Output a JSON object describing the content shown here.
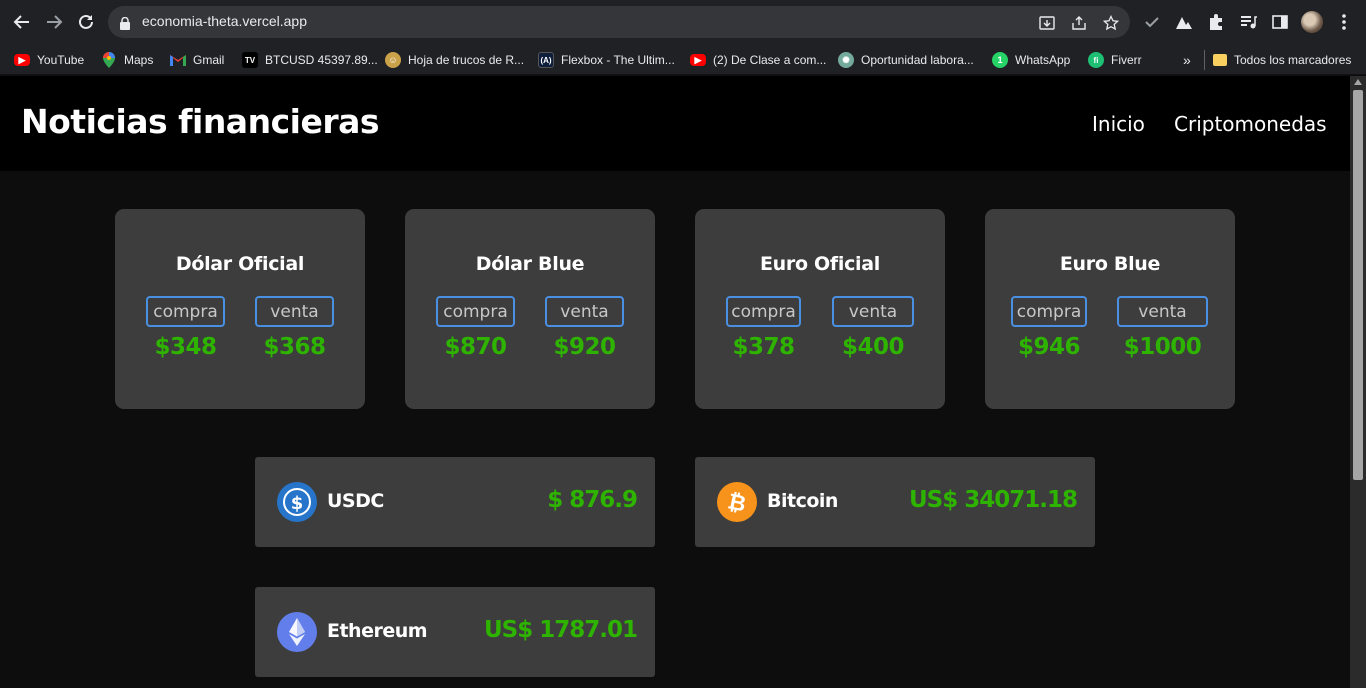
{
  "browser": {
    "url": "economia-theta.vercel.app",
    "bookmarks": [
      {
        "label": "YouTube",
        "icon": "youtube-icon"
      },
      {
        "label": "Maps",
        "icon": "maps-icon"
      },
      {
        "label": "Gmail",
        "icon": "gmail-icon"
      },
      {
        "label": "BTCUSD 45397.89...",
        "icon": "tradingview-icon"
      },
      {
        "label": "Hoja de trucos de R...",
        "icon": "cheatsheet-icon"
      },
      {
        "label": "Flexbox - The Ultim...",
        "icon": "flexbox-icon"
      },
      {
        "label": "(2) De Clase a com...",
        "icon": "youtube-icon"
      },
      {
        "label": "Oportunidad labora...",
        "icon": "chatgpt-icon"
      },
      {
        "label": "WhatsApp",
        "icon": "whatsapp-icon"
      },
      {
        "label": "Fiverr",
        "icon": "fiverr-icon"
      }
    ],
    "overflow": "»",
    "all_bookmarks": "Todos los marcadores"
  },
  "site": {
    "title": "Noticias financieras",
    "nav": [
      "Inicio",
      "Criptomonedas"
    ]
  },
  "currencies": [
    {
      "name": "Dólar Oficial",
      "buy_label": "compra",
      "sell_label": "venta",
      "buy": "$348",
      "sell": "$368"
    },
    {
      "name": "Dólar Blue",
      "buy_label": "compra",
      "sell_label": "venta",
      "buy": "$870",
      "sell": "$920"
    },
    {
      "name": "Euro Oficial",
      "buy_label": "compra",
      "sell_label": "venta",
      "buy": "$378",
      "sell": "$400"
    },
    {
      "name": "Euro Blue",
      "buy_label": "compra",
      "sell_label": "venta",
      "buy": "$946",
      "sell": "$1000"
    }
  ],
  "cryptos": [
    {
      "name": "USDC",
      "price": "$ 876.9",
      "icon": "usdc-icon",
      "color": "#2775ca"
    },
    {
      "name": "Bitcoin",
      "price": "US$ 34071.18",
      "icon": "bitcoin-icon",
      "color": "#f7931a"
    },
    {
      "name": "Ethereum",
      "price": "US$ 1787.01",
      "icon": "ethereum-icon",
      "color": "#627eea"
    }
  ],
  "colors": {
    "value_green": "#2db300",
    "tag_border": "#4a90e2",
    "card_bg": "#3d3d3d"
  }
}
